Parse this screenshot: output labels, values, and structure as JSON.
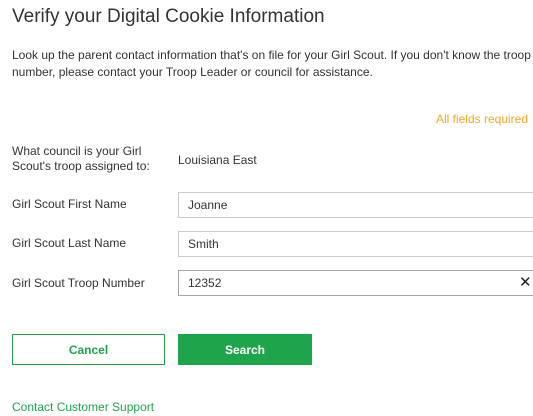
{
  "page": {
    "title": "Verify your Digital Cookie Information",
    "intro": "Look up the parent contact information that's on file for your Girl Scout. If you don't know the troop number, please contact your Troop Leader or council for assistance.",
    "required_note": "All fields required"
  },
  "form": {
    "council": {
      "label": "What council is your Girl Scout's troop assigned to:",
      "value": "Louisiana East"
    },
    "first_name": {
      "label": "Girl Scout First Name",
      "value": "Joanne"
    },
    "last_name": {
      "label": "Girl Scout Last Name",
      "value": "Smith"
    },
    "troop_number": {
      "label": "Girl Scout Troop Number",
      "value": "12352",
      "clear_glyph": "✕"
    }
  },
  "actions": {
    "cancel_label": "Cancel",
    "search_label": "Search"
  },
  "footer": {
    "support_link": "Contact Customer Support"
  },
  "colors": {
    "accent_green": "#1ea54c",
    "required_orange": "#f5a623",
    "text": "#333333"
  }
}
